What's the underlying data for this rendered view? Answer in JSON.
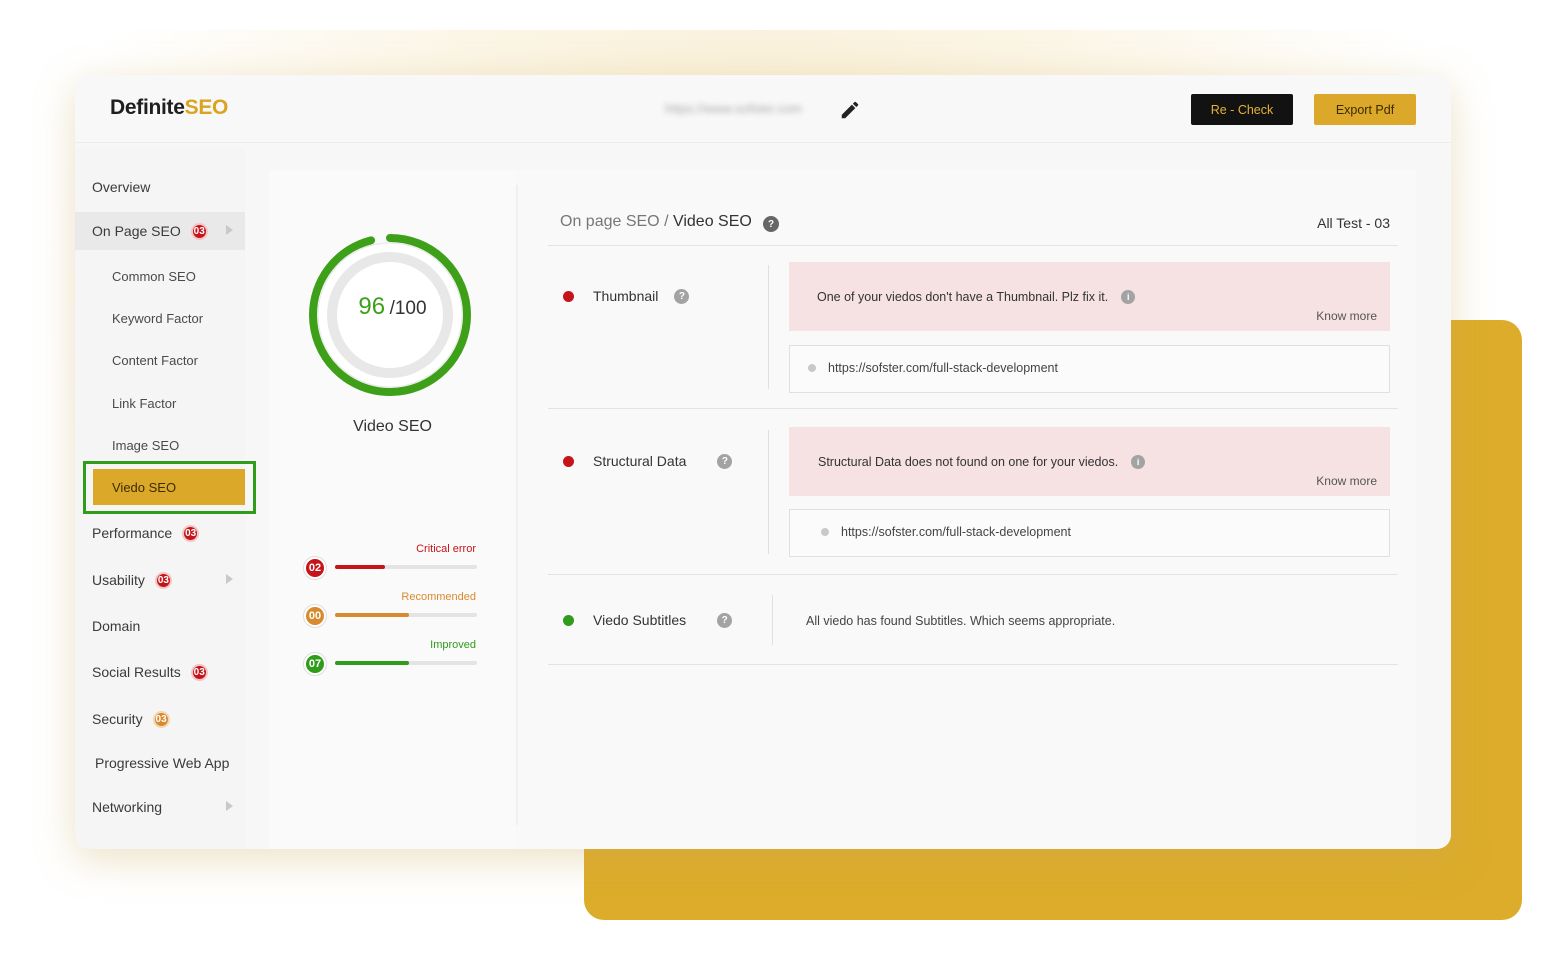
{
  "app": {
    "logo_main": "Definite",
    "logo_accent": "SEO",
    "url": "https://www.sofster.com"
  },
  "toolbar": {
    "recheck_label": "Re - Check",
    "export_label": "Export Pdf"
  },
  "sidebar": {
    "items": [
      {
        "label": "Overview"
      },
      {
        "label": "On Page SEO",
        "badge": "03"
      },
      {
        "label": "Common SEO"
      },
      {
        "label": "Keyword Factor"
      },
      {
        "label": "Content Factor"
      },
      {
        "label": "Link Factor"
      },
      {
        "label": "Image SEO"
      },
      {
        "label": "Viedo SEO"
      },
      {
        "label": "Performance",
        "badge": "03"
      },
      {
        "label": "Usability",
        "badge": "03"
      },
      {
        "label": "Domain"
      },
      {
        "label": "Social Results",
        "badge": "03"
      },
      {
        "label": "Security",
        "badge": "03"
      },
      {
        "label": "Progressive Web App"
      },
      {
        "label": "Networking"
      }
    ]
  },
  "score": {
    "value": "96",
    "max": "/100",
    "fraction": 0.96,
    "label": "Video SEO",
    "stats": [
      {
        "count": "02",
        "label": "Critical error",
        "color": "#c5141a",
        "level": 0.35
      },
      {
        "count": "00",
        "label": "Recommended",
        "color": "#d88b2e",
        "level": 0.52
      },
      {
        "count": "07",
        "label": "Improved",
        "color": "#2f9c1a",
        "level": 0.52
      }
    ]
  },
  "main": {
    "breadcrumb_parent": "On page SEO",
    "breadcrumb_sep": " / ",
    "breadcrumb_current": "Video SEO",
    "all_test": "All Test - 03",
    "tests": [
      {
        "title": "Thumbnail",
        "status_color": "#c5141a",
        "message": "One of your viedos don't have a Thumbnail. Plz fix it.",
        "know_more": "Know more",
        "url": "https://sofster.com/full-stack-development"
      },
      {
        "title": "Structural Data",
        "status_color": "#c5141a",
        "message": "Structural Data does not found on one for your viedos.",
        "know_more": "Know more",
        "url": "https://sofster.com/full-stack-development"
      },
      {
        "title": "Viedo Subtitles",
        "status_color": "#2f9c1a",
        "message": "All viedo has found Subtitles. Which seems appropriate."
      }
    ]
  },
  "icons": {
    "edit": "pencil-icon",
    "help": "question-circle-icon",
    "info": "info-circle-icon",
    "caret": "caret-right-icon"
  },
  "colors": {
    "accent": "#dca82a",
    "critical": "#c5141a",
    "success": "#2f9c1a"
  }
}
